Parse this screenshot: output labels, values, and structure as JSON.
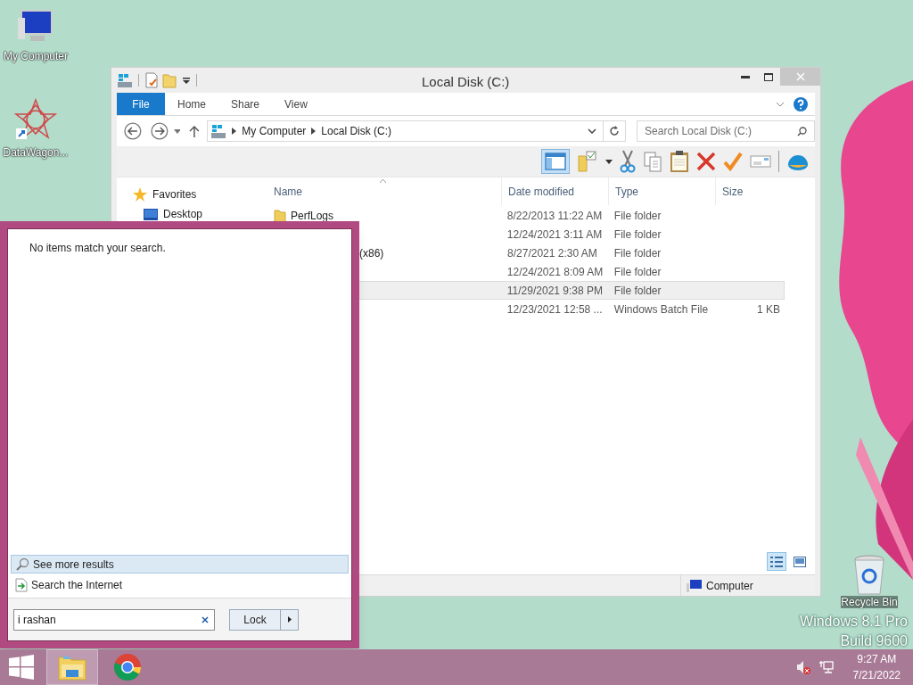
{
  "desktop_icons": [
    {
      "kind": "computer",
      "label": "My Computer"
    },
    {
      "kind": "app",
      "label": "DataWagon..."
    }
  ],
  "recycle_bin": {
    "label": "Recycle Bin"
  },
  "os_watermark": {
    "edition": "Windows 8.1 Pro",
    "build": "Build 9600"
  },
  "explorer": {
    "title": "Local Disk (C:)",
    "ribbon_tabs": [
      {
        "label": "File",
        "selected": true
      },
      {
        "label": "Home",
        "selected": false
      },
      {
        "label": "Share",
        "selected": false
      },
      {
        "label": "View",
        "selected": false
      }
    ],
    "breadcrumbs": [
      "My Computer",
      "Local Disk (C:)"
    ],
    "search": {
      "placeholder": "Search Local Disk (C:)"
    },
    "sidebar": [
      {
        "kind": "favorites",
        "label": "Favorites"
      },
      {
        "kind": "desktop",
        "label": "Desktop"
      }
    ],
    "columns": [
      "Name",
      "Date modified",
      "Type",
      "Size"
    ],
    "rows": [
      {
        "kind": "folder",
        "name": "PerfLogs",
        "date": "8/22/2013 11:22 AM",
        "type": "File folder",
        "size": "",
        "highlighted": false
      },
      {
        "kind": "hidden",
        "name": "",
        "date": "12/24/2021 3:11 AM",
        "type": "File folder",
        "size": "",
        "highlighted": false
      },
      {
        "kind": "clipped",
        "name": "(x86)",
        "date": "8/27/2021 2:30 AM",
        "type": "File folder",
        "size": "",
        "highlighted": false
      },
      {
        "kind": "hidden",
        "name": "",
        "date": "12/24/2021 8:09 AM",
        "type": "File folder",
        "size": "",
        "highlighted": false
      },
      {
        "kind": "hidden",
        "name": "",
        "date": "11/29/2021 9:38 PM",
        "type": "File folder",
        "size": "",
        "highlighted": true
      },
      {
        "kind": "hidden",
        "name": "",
        "date": "12/23/2021 12:58 ...",
        "type": "Windows Batch File",
        "size": "1 KB",
        "highlighted": false
      }
    ],
    "status": {
      "location": "Computer"
    },
    "views": [
      {
        "kind": "details",
        "selected": true
      },
      {
        "kind": "preview",
        "selected": false
      }
    ]
  },
  "start_menu": {
    "message": "No items match your search.",
    "links": [
      {
        "kind": "more",
        "label": "See more results",
        "highlighted": true
      },
      {
        "kind": "internet",
        "label": "Search the Internet",
        "highlighted": false
      }
    ],
    "search_value": "i rashan",
    "power_button": "Lock"
  },
  "taskbar": {
    "apps": [
      {
        "kind": "explorer",
        "active": true
      },
      {
        "kind": "chrome",
        "active": false
      }
    ],
    "time": "9:27 AM",
    "date": "7/21/2022"
  }
}
